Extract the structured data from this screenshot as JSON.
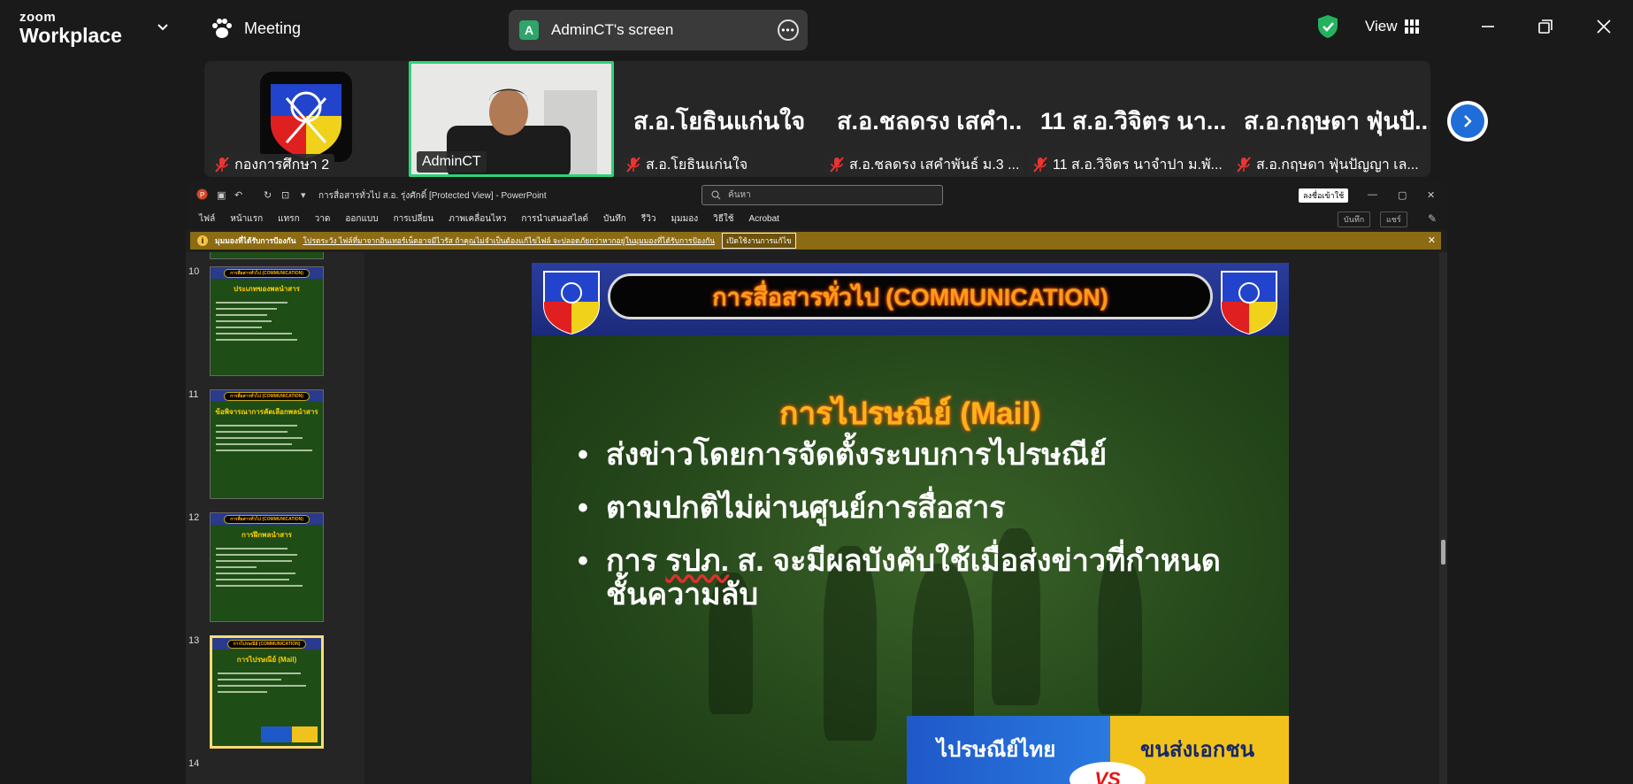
{
  "app": {
    "logo_line1": "zoom",
    "logo_line2": "Workplace",
    "meeting_label": "Meeting",
    "view_label": "View"
  },
  "share": {
    "badge": "A",
    "title": "AdminCT's screen",
    "more": "•••"
  },
  "gallery": {
    "tiles": [
      {
        "big": "",
        "label": "กองการศึกษา 2"
      },
      {
        "big": "",
        "label": "AdminCT"
      },
      {
        "big": "ส.อ.โยธินแก่นใจ",
        "label": "ส.อ.โยธินแก่นใจ"
      },
      {
        "big": "ส.อ.ชลดรง เสคำ...",
        "label": "ส.อ.ชลดรง เสคำพันธ์ ม.3 ..."
      },
      {
        "big": "11 ส.อ.วิจิตร นา...",
        "label": "11 ส.อ.วิจิตร นาจำปา ม.พั..."
      },
      {
        "big": "ส.อ.กฤษดา ฟุ่นปั...",
        "label": "ส.อ.กฤษดา ฟุ่นปัญญา เล..."
      }
    ]
  },
  "ppt": {
    "doc_title": "การสื่อสารทั่วไป ส.อ. รุ่งศักดิ์ [Protected View] - PowerPoint",
    "search_placeholder": "ค้นหา",
    "signin": "ลงชื่อเข้าใช้",
    "menu": [
      "ไฟล์",
      "หน้าแรก",
      "แทรก",
      "วาด",
      "ออกแบบ",
      "การเปลี่ยน",
      "ภาพเคลื่อนไหว",
      "การนำเสนอสไลด์",
      "บันทึก",
      "รีวิว",
      "มุมมอง",
      "วิธีใช้",
      "Acrobat"
    ],
    "menu_right": [
      "บันทึก",
      "แชร์"
    ],
    "warning": {
      "title": "มุมมองที่ได้รับการป้องกัน",
      "text": "โปรดระวัง ไฟล์ที่มาจากอินเทอร์เน็ตอาจมีไวรัส ถ้าคุณไม่จำเป็นต้องแก้ไขไฟล์ จะปลอดภัยกว่าหากอยู่ในมุมมองที่ได้รับการป้องกัน",
      "button": "เปิดใช้งานการแก้ไข"
    },
    "thumbs": [
      {
        "num": "10",
        "head": "การสื่อสารทั่วไป (COMMUNICATION)",
        "title": "ประเภทของพลนำสาร"
      },
      {
        "num": "11",
        "head": "การสื่อสารทั่วไป (COMMUNICATION)",
        "title": "ข้อพิจารณาการคัดเลือกพลนำสาร"
      },
      {
        "num": "12",
        "head": "การสื่อสารทั่วไป (COMMUNICATION)",
        "title": "การฝึกพลนำสาร"
      },
      {
        "num": "13",
        "head": "การไปรษณีย์ (COMMUNICATION)",
        "title": "การไปรษณีย์ (Mail)"
      },
      {
        "num": "14"
      }
    ],
    "slide": {
      "header": "การสื่อสารทั่วไป (COMMUNICATION)",
      "subtitle": "การไปรษณีย์ (Mail)",
      "bullet1": "ส่งข่าวโดยการจัดตั้งระบบการไปรษณีย์",
      "bullet2": "ตามปกติไม่ผ่านศูนย์การสื่อสาร",
      "bullet3_a": "การ ",
      "bullet3_b": "รปภ.",
      "bullet3_c": " ส. จะมีผลบังคับใช้เมื่อส่งข่าวที่กำหนดชั้นความลับ",
      "ad_left": "ไปรษณีย์ไทย",
      "ad_right": "ขนส่งเอกชน",
      "ad_vs": "VS"
    }
  },
  "colors": {
    "accent_green": "#2fd17a",
    "zoom_blue": "#1f6dd8",
    "slide_title_orange": "#ff9a1a"
  }
}
